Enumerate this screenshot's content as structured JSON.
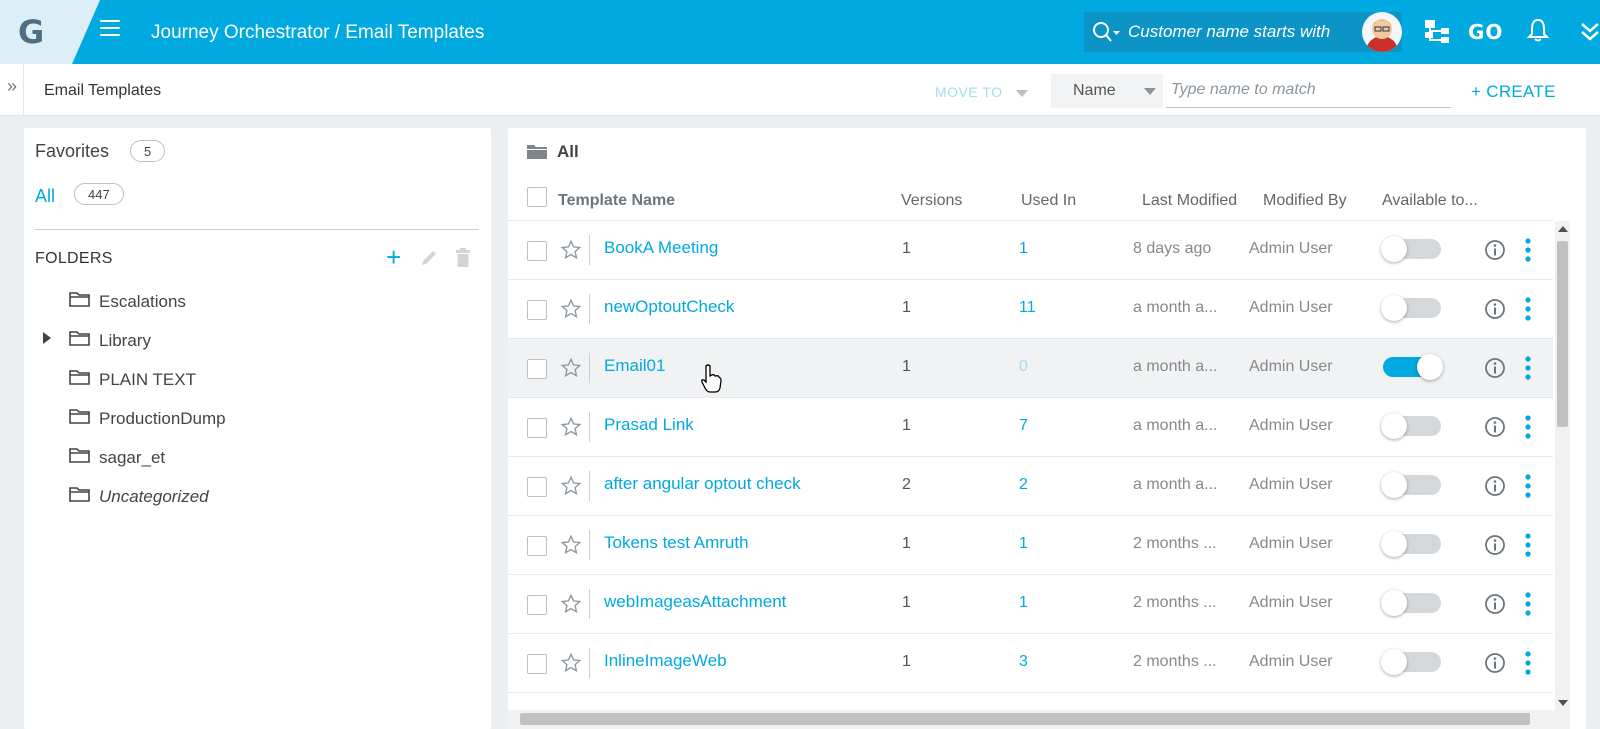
{
  "header": {
    "logo_letter": "G",
    "breadcrumb": "Journey Orchestrator / Email Templates",
    "search_placeholder": "Customer name starts with",
    "go_label": "GO",
    "accent_color": "#00a9e0"
  },
  "toolbar": {
    "page_name": "Email Templates",
    "move_to_label": "MOVE TO",
    "filter_field": "Name",
    "filter_placeholder": "Type name to match",
    "create_label": "+ CREATE"
  },
  "sidebar": {
    "favorites_label": "Favorites",
    "favorites_count": "5",
    "all_label": "All",
    "all_count": "447",
    "folders_label": "FOLDERS",
    "folders": [
      {
        "label": "Escalations",
        "expandable": false,
        "italic": false
      },
      {
        "label": "Library",
        "expandable": true,
        "italic": false
      },
      {
        "label": "PLAIN TEXT",
        "expandable": false,
        "italic": false
      },
      {
        "label": "ProductionDump",
        "expandable": false,
        "italic": false
      },
      {
        "label": "sagar_et",
        "expandable": false,
        "italic": false
      },
      {
        "label": "Uncategorized",
        "expandable": false,
        "italic": true
      }
    ]
  },
  "main": {
    "folder_title": "All",
    "columns": {
      "name": "Template Name",
      "versions": "Versions",
      "used_in": "Used In",
      "last_modified": "Last Modified",
      "modified_by": "Modified By",
      "available": "Available to..."
    },
    "rows": [
      {
        "name": "BookA Meeting",
        "versions": "1",
        "used_in": "1",
        "last_modified": "8 days ago",
        "modified_by": "Admin User",
        "available": false
      },
      {
        "name": "newOptoutCheck",
        "versions": "1",
        "used_in": "11",
        "last_modified": "a month a...",
        "modified_by": "Admin User",
        "available": false
      },
      {
        "name": "Email01",
        "versions": "1",
        "used_in": "0",
        "last_modified": "a month a...",
        "modified_by": "Admin User",
        "available": true
      },
      {
        "name": "Prasad Link",
        "versions": "1",
        "used_in": "7",
        "last_modified": "a month a...",
        "modified_by": "Admin User",
        "available": false
      },
      {
        "name": "after angular optout check",
        "versions": "2",
        "used_in": "2",
        "last_modified": "a month a...",
        "modified_by": "Admin User",
        "available": false
      },
      {
        "name": "Tokens test Amruth",
        "versions": "1",
        "used_in": "1",
        "last_modified": "2 months ...",
        "modified_by": "Admin User",
        "available": false
      },
      {
        "name": "webImageasAttachment",
        "versions": "1",
        "used_in": "1",
        "last_modified": "2 months ...",
        "modified_by": "Admin User",
        "available": false
      },
      {
        "name": "InlineImageWeb",
        "versions": "1",
        "used_in": "3",
        "last_modified": "2 months ...",
        "modified_by": "Admin User",
        "available": false
      }
    ]
  }
}
